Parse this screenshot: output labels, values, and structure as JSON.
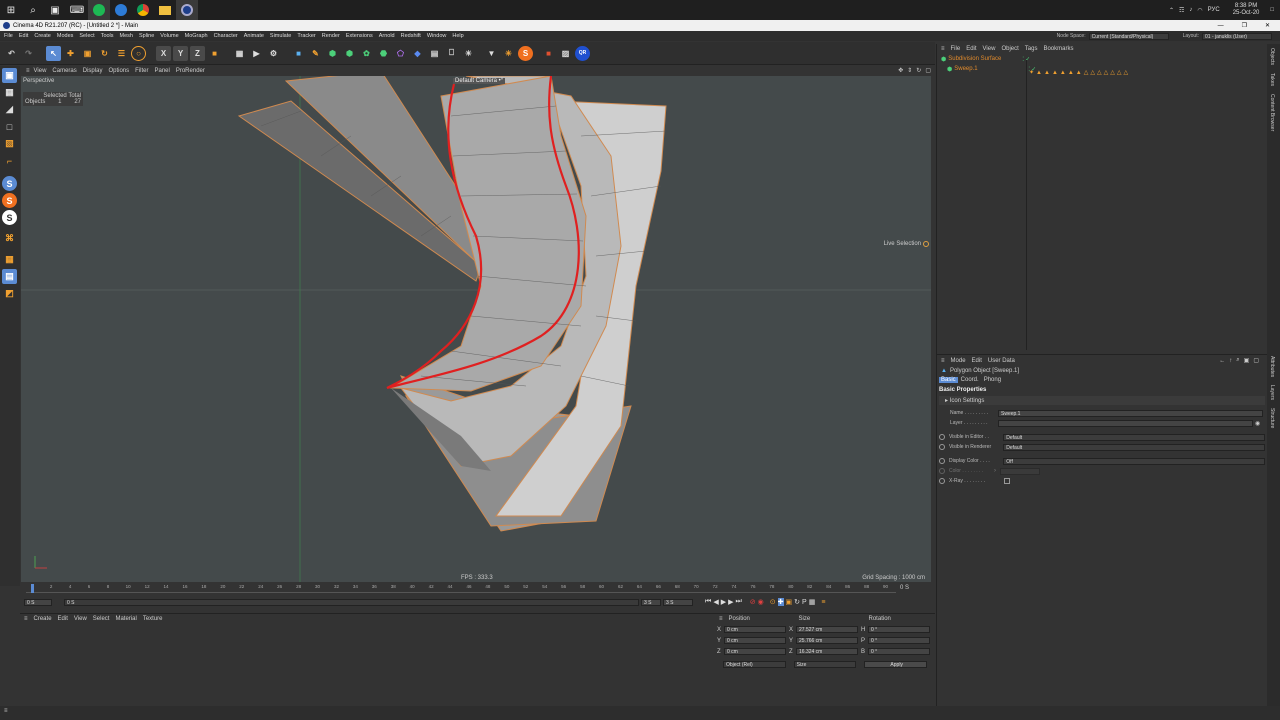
{
  "taskbar": {
    "time": "8:38 PM",
    "date": "25-Oct-20",
    "lang": "РУС"
  },
  "window": {
    "title": "Cinema 4D R21.207 (RC) - [Untitled 2 *] - Main"
  },
  "menubar": {
    "items": [
      "File",
      "Edit",
      "Create",
      "Modes",
      "Select",
      "Tools",
      "Mesh",
      "Spline",
      "Volume",
      "MoGraph",
      "Character",
      "Animate",
      "Simulate",
      "Tracker",
      "Render",
      "Extensions",
      "Arnold",
      "Redshift",
      "Window",
      "Help"
    ],
    "node_space_label": "Node Space:",
    "node_space_value": "Current (Standard/Physical)",
    "layout_label": "Layout:",
    "layout_value": "01 - januklis (User)"
  },
  "viewport": {
    "menu": [
      "View",
      "Cameras",
      "Display",
      "Options",
      "Filter",
      "Panel",
      "ProRender"
    ],
    "label": "Perspective",
    "camera": "Default Camera •°",
    "selected_total": "Selected Total",
    "objects_label": "Objects",
    "objects_selected": "1",
    "objects_total": "27",
    "live_selection": "Live Selection",
    "fps": "FPS : 333.3",
    "grid_spacing": "Grid Spacing : 1000 cm"
  },
  "timeline": {
    "ticks": [
      "0",
      "2",
      "4",
      "6",
      "8",
      "10",
      "12",
      "14",
      "16",
      "18",
      "20",
      "22",
      "24",
      "26",
      "28",
      "30",
      "32",
      "34",
      "36",
      "38",
      "40",
      "42",
      "44",
      "46",
      "48",
      "50",
      "52",
      "54",
      "56",
      "58",
      "60",
      "62",
      "64",
      "66",
      "68",
      "70",
      "72",
      "74",
      "76",
      "78",
      "80",
      "82",
      "84",
      "86",
      "88",
      "90"
    ],
    "frame_end": "0 S",
    "start_field": "0 S",
    "start_field2": "0 S",
    "end_field": "3 S",
    "end_field2": "3 S"
  },
  "materials": {
    "menu": [
      "Create",
      "Edit",
      "View",
      "Select",
      "Material",
      "Texture"
    ]
  },
  "coords": {
    "headers": [
      "Position",
      "Size",
      "Rotation"
    ],
    "rows": [
      {
        "axis": "X",
        "pos": "0 cm",
        "saxis": "X",
        "size": "27.527 cm",
        "raxis": "H",
        "rot": "0 °"
      },
      {
        "axis": "Y",
        "pos": "0 cm",
        "saxis": "Y",
        "size": "25.766 cm",
        "raxis": "P",
        "rot": "0 °"
      },
      {
        "axis": "Z",
        "pos": "0 cm",
        "saxis": "Z",
        "size": "16.324 cm",
        "raxis": "B",
        "rot": "0 °"
      }
    ],
    "mode": "Object (Rel)",
    "size_mode": "Size",
    "apply": "Apply"
  },
  "objects": {
    "menu": [
      "File",
      "Edit",
      "View",
      "Object",
      "Tags",
      "Bookmarks"
    ],
    "items": [
      {
        "name": "Subdivision Surface",
        "color": "#e08a2c"
      },
      {
        "name": "Sweep.1",
        "color": "#e08a2c"
      }
    ]
  },
  "right_tabs_top": [
    "Objects",
    "Takes",
    "Content Browser"
  ],
  "right_tabs_bottom": [
    "Attributes",
    "Layers",
    "Structure"
  ],
  "attributes": {
    "menu": [
      "Mode",
      "Edit",
      "User Data"
    ],
    "object_title": "Polygon Object [Sweep.1]",
    "tabs": [
      "Basic",
      "Coord.",
      "Phong"
    ],
    "section": "Basic Properties",
    "icon_settings": "Icon Settings",
    "name_label": "Name . . . . . . . . .",
    "name_value": "Sweep.1",
    "layer_label": "Layer . . . . . . . . .",
    "visible_editor_label": "Visible in Editor . .",
    "visible_editor_value": "Default",
    "visible_renderer_label": "Visible in Renderer",
    "visible_renderer_value": "Default",
    "display_color_label": "Display Color . . . .",
    "display_color_value": "Off",
    "color_label": "Color . . . . . . . .",
    "xray_label": "X-Ray . . . . . . . ."
  }
}
